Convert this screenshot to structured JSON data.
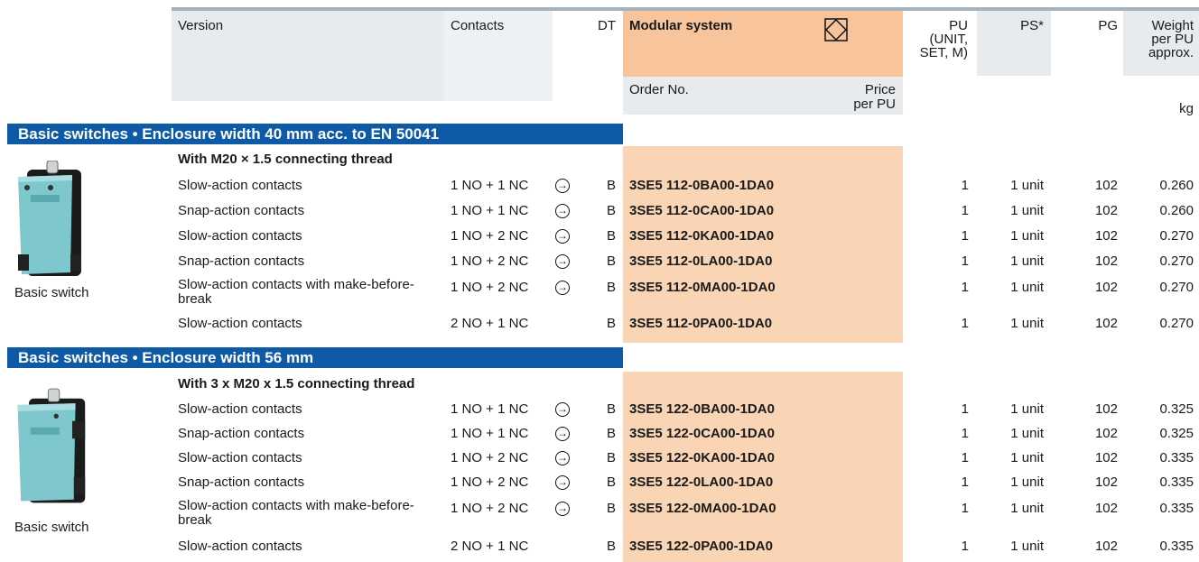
{
  "header": {
    "version": "Version",
    "contacts": "Contacts",
    "dt": "DT",
    "modular_system": "Modular system",
    "pu": "PU\n(UNIT,\nSET, M)",
    "ps": "PS*",
    "pg": "PG",
    "weight": "Weight\nper PU\napprox.",
    "order_no": "Order No.",
    "price": "Price\nper PU",
    "kg": "kg"
  },
  "sections": [
    {
      "title": "Basic switches • Enclosure width 40 mm acc. to EN 50041",
      "subheading": "With M20 × 1.5 connecting thread",
      "image_caption": "Basic switch",
      "rows": [
        {
          "version": "Slow-action contacts",
          "contacts": "1 NO + 1 NC",
          "arrow": true,
          "dt": "B",
          "order": "3SE5 112-0BA00-1DA0",
          "pu": "1",
          "ps": "1 unit",
          "pg": "102",
          "weight": "0.260"
        },
        {
          "version": "Snap-action contacts",
          "contacts": "1 NO + 1 NC",
          "arrow": true,
          "dt": "B",
          "order": "3SE5 112-0CA00-1DA0",
          "pu": "1",
          "ps": "1 unit",
          "pg": "102",
          "weight": "0.260"
        },
        {
          "version": "Slow-action contacts",
          "contacts": "1 NO + 2 NC",
          "arrow": true,
          "dt": "B",
          "order": "3SE5 112-0KA00-1DA0",
          "pu": "1",
          "ps": "1 unit",
          "pg": "102",
          "weight": "0.270"
        },
        {
          "version": "Snap-action contacts",
          "contacts": "1 NO + 2 NC",
          "arrow": true,
          "dt": "B",
          "order": "3SE5 112-0LA00-1DA0",
          "pu": "1",
          "ps": "1 unit",
          "pg": "102",
          "weight": "0.270"
        },
        {
          "version": "Slow-action contacts with make-before-break",
          "contacts": "1 NO + 2 NC",
          "arrow": true,
          "dt": "B",
          "order": "3SE5 112-0MA00-1DA0",
          "pu": "1",
          "ps": "1 unit",
          "pg": "102",
          "weight": "0.270"
        },
        {
          "version": "Slow-action contacts",
          "contacts": "2 NO + 1 NC",
          "arrow": false,
          "dt": "B",
          "order": "3SE5 112-0PA00-1DA0",
          "pu": "1",
          "ps": "1 unit",
          "pg": "102",
          "weight": "0.270"
        }
      ]
    },
    {
      "title": "Basic switches • Enclosure width 56 mm",
      "subheading": "With 3 x M20 x 1.5 connecting thread",
      "image_caption": "Basic switch",
      "rows": [
        {
          "version": "Slow-action contacts",
          "contacts": "1 NO + 1 NC",
          "arrow": true,
          "dt": "B",
          "order": "3SE5 122-0BA00-1DA0",
          "pu": "1",
          "ps": "1 unit",
          "pg": "102",
          "weight": "0.325"
        },
        {
          "version": "Snap-action contacts",
          "contacts": "1 NO + 1 NC",
          "arrow": true,
          "dt": "B",
          "order": "3SE5 122-0CA00-1DA0",
          "pu": "1",
          "ps": "1 unit",
          "pg": "102",
          "weight": "0.325"
        },
        {
          "version": "Slow-action contacts",
          "contacts": "1 NO + 2 NC",
          "arrow": true,
          "dt": "B",
          "order": "3SE5 122-0KA00-1DA0",
          "pu": "1",
          "ps": "1 unit",
          "pg": "102",
          "weight": "0.335"
        },
        {
          "version": "Snap-action contacts",
          "contacts": "1 NO + 2 NC",
          "arrow": true,
          "dt": "B",
          "order": "3SE5 122-0LA00-1DA0",
          "pu": "1",
          "ps": "1 unit",
          "pg": "102",
          "weight": "0.335"
        },
        {
          "version": "Slow-action contacts with make-before-break",
          "contacts": "1 NO + 2 NC",
          "arrow": true,
          "dt": "B",
          "order": "3SE5 122-0MA00-1DA0",
          "pu": "1",
          "ps": "1 unit",
          "pg": "102",
          "weight": "0.335"
        },
        {
          "version": "Slow-action contacts",
          "contacts": "2 NO + 1 NC",
          "arrow": false,
          "dt": "B",
          "order": "3SE5 122-0PA00-1DA0",
          "pu": "1",
          "ps": "1 unit",
          "pg": "102",
          "weight": "0.335"
        }
      ]
    }
  ],
  "colors": {
    "section_bar": "#0e5aa7",
    "header_bg": "#e7ebee",
    "modular_bg": "#f9d5b6",
    "modular_header": "#f8c49c",
    "product": "#7ec7cc"
  },
  "icons": {
    "arrow": "circled-right-arrow-icon",
    "modular": "diamond-square-icon"
  }
}
